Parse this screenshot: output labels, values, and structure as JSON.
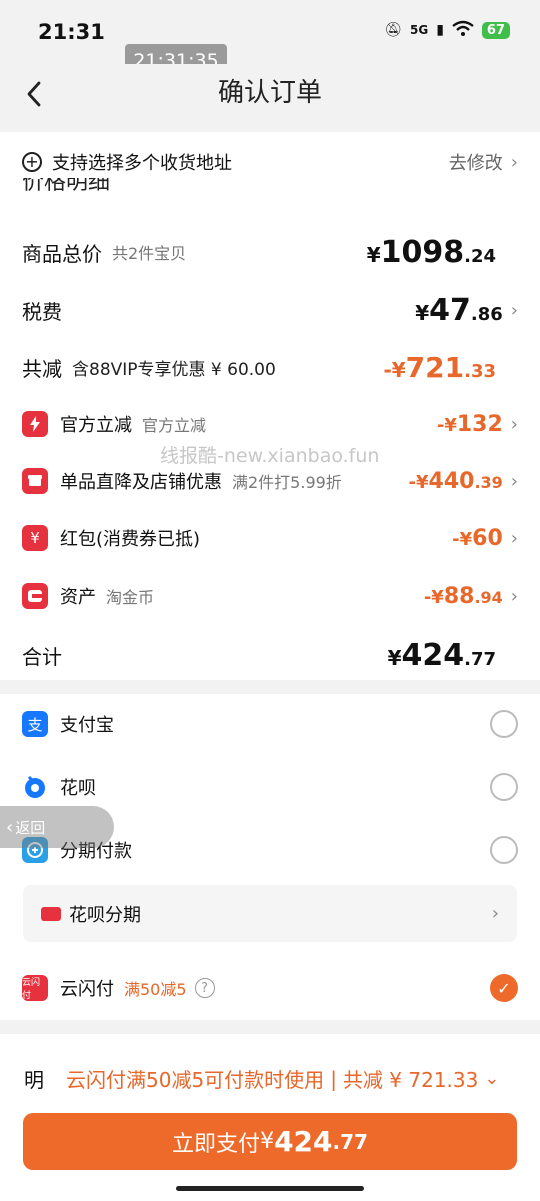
{
  "status": {
    "time": "21:31",
    "network": "5G",
    "battery": "67",
    "time_overlay": "21:31:35"
  },
  "header": {
    "title": "确认订单"
  },
  "address": {
    "label": "支持选择多个收货地址",
    "action": "去修改"
  },
  "section_title": "价格明细",
  "price": {
    "total": {
      "label": "商品总价",
      "sub": "共2件宝贝",
      "currency": "¥",
      "int": "1098",
      "dec": ".24"
    },
    "tax": {
      "label": "税费",
      "currency": "¥",
      "int": "47",
      "dec": ".86"
    },
    "reduce": {
      "label": "共减",
      "sub": "含88VIP专享优惠 ¥ 60.00",
      "prefix": "-¥",
      "int": "721",
      "dec": ".33"
    },
    "items": [
      {
        "icon": "lightning-icon",
        "label": "官方立减",
        "sub": "官方立减",
        "prefix": "-¥",
        "int": "132",
        "dec": ""
      },
      {
        "icon": "shop-icon",
        "label": "单品直降及店铺优惠",
        "sub": "满2件打5.99折",
        "prefix": "-¥",
        "int": "440",
        "dec": ".39"
      },
      {
        "icon": "redpacket-icon",
        "icon_glyph": "¥",
        "label": "红包(消费券已抵)",
        "sub": "",
        "prefix": "-¥",
        "int": "60",
        "dec": ""
      },
      {
        "icon": "coin-icon",
        "label": "资产",
        "sub": "淘金币",
        "prefix": "-¥",
        "int": "88",
        "dec": ".94"
      }
    ],
    "sum": {
      "label": "合计",
      "currency": "¥",
      "int": "424",
      "dec": ".77"
    }
  },
  "watermark": "线报酷-new.xianbao.fun",
  "payments": {
    "alipay": "支付宝",
    "alipay_glyph": "支",
    "huabei": "花呗",
    "installment": "分期付款",
    "huabei_installment": "花呗分期",
    "unionpay": "云闪付",
    "unionpay_glyph": "云闪付",
    "unionpay_promo": "满50减5",
    "help_glyph": "?",
    "return_label": "返回"
  },
  "bottom": {
    "prefix": "明",
    "promo": "云闪付满50减5可付款时使用",
    "separator": "|",
    "total_reduce": "共减 ¥ 721.33"
  },
  "pay_button": {
    "label": "立即支付",
    "currency": "¥",
    "int": "424",
    "dec": ".77"
  },
  "colors": {
    "accent": "#ee6a2b",
    "red_icon": "#e6323e",
    "alipay_blue": "#1677ff"
  }
}
